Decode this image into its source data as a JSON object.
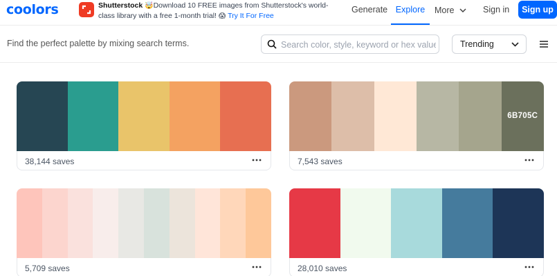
{
  "brand": {
    "logo_text": "coolors",
    "accent": "#0066ff"
  },
  "ad": {
    "brand": "Shutterstock",
    "emoji_1": "🤯",
    "text": "Download 10 FREE images from Shutterstock's world-class library with a free 1-month trial!",
    "emoji_2": "😱",
    "link": "Try It For Free",
    "logo_color": "#ef3b24",
    "icon": "shutterstock-icon"
  },
  "nav": {
    "generate": "Generate",
    "explore": "Explore",
    "more": "More",
    "signin": "Sign in",
    "signup": "Sign up",
    "active": "Explore"
  },
  "subbar": {
    "hint": "Find the perfect palette by mixing search terms.",
    "search_placeholder": "Search color, style, keyword or hex value",
    "sort_value": "Trending",
    "icons": [
      "search-icon",
      "chevron-down-icon",
      "menu-icon"
    ]
  },
  "palettes": [
    {
      "colors": [
        "#264653",
        "#2a9d8f",
        "#e9c46a",
        "#f4a261",
        "#e76f51"
      ],
      "saves": "38,144 saves",
      "shown_code": null
    },
    {
      "colors": [
        "#cb997e",
        "#ddbea9",
        "#ffe8d6",
        "#b7b7a4",
        "#a5a58d",
        "#6b705c"
      ],
      "saves": "7,543 saves",
      "shown_code": "6B705C"
    },
    {
      "colors": [
        "#fec5bb",
        "#fcd5ce",
        "#fae1dd",
        "#f8edeb",
        "#e8e8e4",
        "#d8e2dc",
        "#ece4db",
        "#ffe5d9",
        "#ffd7ba",
        "#fec89a"
      ],
      "saves": "5,709 saves",
      "shown_code": null
    },
    {
      "colors": [
        "#e63946",
        "#f1faee",
        "#a8dadc",
        "#457b9d",
        "#1d3557"
      ],
      "saves": "28,010 saves",
      "shown_code": null
    }
  ]
}
